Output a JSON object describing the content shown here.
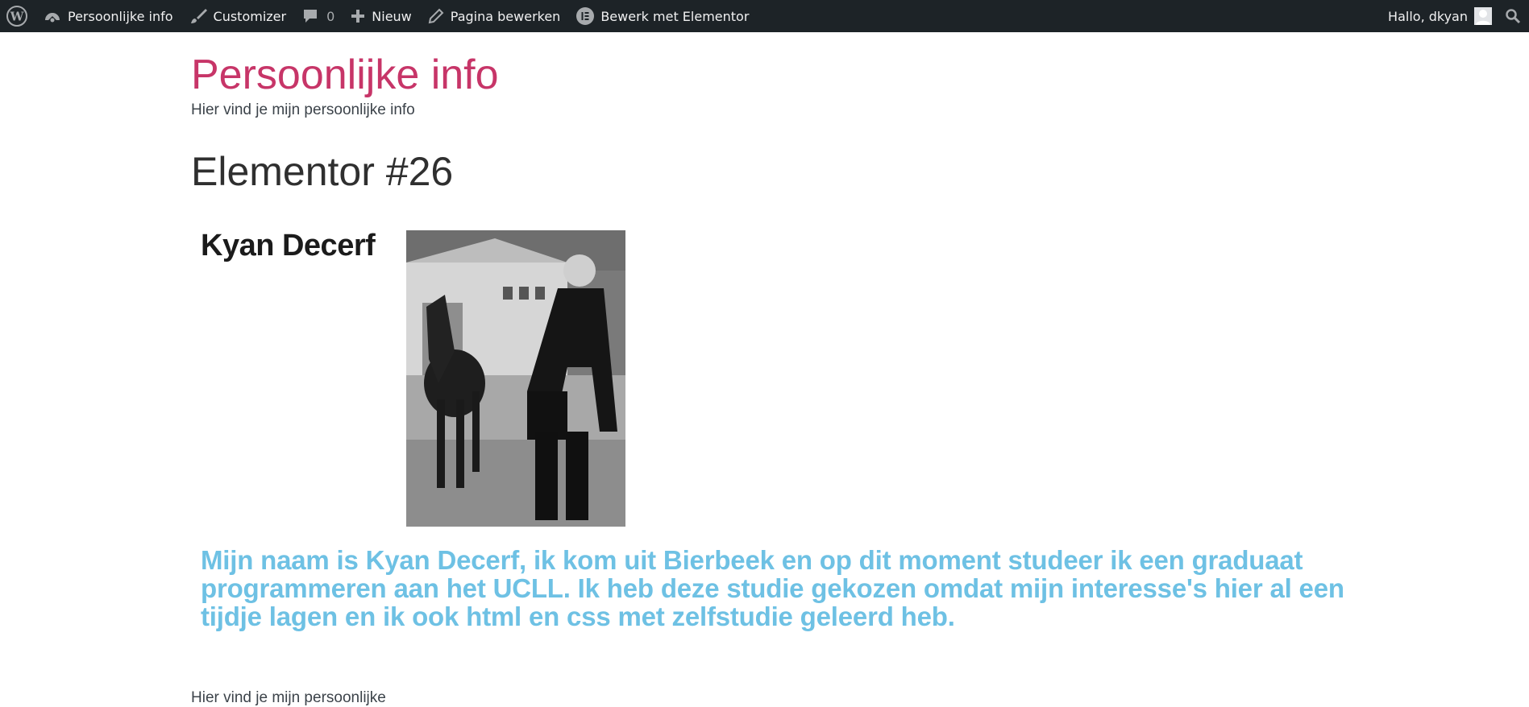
{
  "adminbar": {
    "site_name": "Persoonlijke info",
    "customizer": "Customizer",
    "comments_count": "0",
    "new": "Nieuw",
    "edit_page": "Pagina bewerken",
    "edit_elementor": "Bewerk met Elementor",
    "greeting": "Hallo, dkyan",
    "icons": [
      "wordpress-icon",
      "dashboard-icon",
      "brush-icon",
      "comment-icon",
      "plus-icon",
      "pencil-icon",
      "elementor-icon",
      "avatar-icon",
      "search-icon"
    ]
  },
  "site": {
    "title": "Persoonlijke info",
    "description": "Hier vind je mijn persoonlijke info"
  },
  "page": {
    "title": "Elementor #26",
    "name": "Kyan Decerf",
    "bio": "Mijn naam is Kyan Decerf, ik kom uit Bierbeek en op dit moment studeer ik een graduaat programmeren aan het UCLL. Ik heb deze studie gekozen omdat mijn interesse's hier al een tijdje lagen en ik ook html en css met zelfstudie geleerd heb."
  },
  "footer": {
    "description": "Hier vind je mijn persoonlijke"
  },
  "colors": {
    "adminbar_bg": "#1d2327",
    "site_title": "#c73568",
    "bio_text": "#6ec1e4"
  }
}
